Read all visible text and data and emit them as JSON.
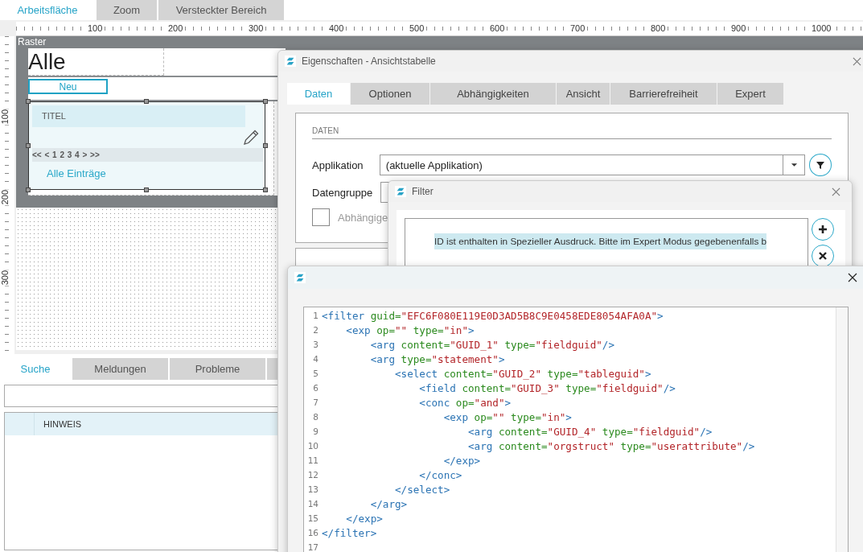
{
  "top_tabs": [
    {
      "label": "Arbeitsfläche",
      "selected": true
    },
    {
      "label": "Zoom",
      "selected": false
    },
    {
      "label": "Versteckter Bereich",
      "selected": false
    }
  ],
  "ruler": {
    "horizontal": [
      "100",
      "200",
      "300",
      "400",
      "500",
      "600",
      "700",
      "800",
      "900",
      "1000"
    ],
    "vertical": [
      "100",
      "200",
      "300"
    ]
  },
  "canvas": {
    "label": "Raster",
    "heading": "Alle",
    "new_button": "Neu",
    "table": {
      "header": "TITEL",
      "pager": "<< < 1 2 3 4 > >>",
      "footer_link": "Alle Einträge"
    }
  },
  "bottom_panel": {
    "tabs": [
      {
        "label": "Suche",
        "selected": true
      },
      {
        "label": "Meldungen",
        "selected": false
      },
      {
        "label": "Probleme",
        "selected": false
      }
    ],
    "table": {
      "columns": [
        "HINWEIS"
      ]
    }
  },
  "properties_dialog": {
    "title": "Eigenschaften - Ansichtstabelle",
    "tabs": [
      {
        "label": "Daten",
        "selected": true
      },
      {
        "label": "Optionen",
        "selected": false
      },
      {
        "label": "Abhängigkeiten",
        "selected": false
      },
      {
        "label": "Ansicht",
        "selected": false
      },
      {
        "label": "Barrierefreiheit",
        "selected": false
      },
      {
        "label": "Expert",
        "selected": false
      }
    ],
    "section": "DATEN",
    "application": {
      "label": "Applikation",
      "value": "(aktuelle Applikation)"
    },
    "data_group": {
      "label": "Datengruppe"
    },
    "checkbox": {
      "label": "Abhängige",
      "checked": false
    }
  },
  "filter_dialog": {
    "title": "Filter",
    "condition": "ID ist enthalten in Spezieller Ausdruck. Bitte im Expert Modus gegebenenfalls b"
  },
  "editor_dialog": {
    "lines": [
      {
        "number": "1",
        "segments": [
          {
            "kind": "tag",
            "text": "<filter "
          },
          {
            "kind": "attr",
            "text": "guid="
          },
          {
            "kind": "value",
            "text": "\"EFC6F080E119E0D3AD5B8C9E0458EDE8054AFA0A\""
          },
          {
            "kind": "tag",
            "text": ">"
          }
        ]
      },
      {
        "number": "2",
        "segments": [
          {
            "kind": "tag",
            "text": "    <exp "
          },
          {
            "kind": "attr",
            "text": "op="
          },
          {
            "kind": "value",
            "text": "\"\""
          },
          {
            "kind": "attr",
            "text": " type="
          },
          {
            "kind": "value",
            "text": "\"in\""
          },
          {
            "kind": "tag",
            "text": ">"
          }
        ]
      },
      {
        "number": "3",
        "segments": [
          {
            "kind": "tag",
            "text": "        <arg "
          },
          {
            "kind": "attr",
            "text": "content="
          },
          {
            "kind": "value",
            "text": "\"GUID_1\""
          },
          {
            "kind": "attr",
            "text": " type="
          },
          {
            "kind": "value",
            "text": "\"fieldguid\""
          },
          {
            "kind": "tag",
            "text": "/>"
          }
        ]
      },
      {
        "number": "4",
        "segments": [
          {
            "kind": "tag",
            "text": "        <arg "
          },
          {
            "kind": "attr",
            "text": "type="
          },
          {
            "kind": "value",
            "text": "\"statement\""
          },
          {
            "kind": "tag",
            "text": ">"
          }
        ]
      },
      {
        "number": "5",
        "segments": [
          {
            "kind": "tag",
            "text": "            <select "
          },
          {
            "kind": "attr",
            "text": "content="
          },
          {
            "kind": "value",
            "text": "\"GUID_2\""
          },
          {
            "kind": "attr",
            "text": " type="
          },
          {
            "kind": "value",
            "text": "\"tableguid\""
          },
          {
            "kind": "tag",
            "text": ">"
          }
        ]
      },
      {
        "number": "6",
        "segments": [
          {
            "kind": "tag",
            "text": "                <field "
          },
          {
            "kind": "attr",
            "text": "content="
          },
          {
            "kind": "value",
            "text": "\"GUID_3\""
          },
          {
            "kind": "attr",
            "text": " type="
          },
          {
            "kind": "value",
            "text": "\"fieldguid\""
          },
          {
            "kind": "tag",
            "text": "/>"
          }
        ]
      },
      {
        "number": "7",
        "segments": [
          {
            "kind": "tag",
            "text": "                <conc "
          },
          {
            "kind": "attr",
            "text": "op="
          },
          {
            "kind": "value",
            "text": "\"and\""
          },
          {
            "kind": "tag",
            "text": ">"
          }
        ]
      },
      {
        "number": "8",
        "segments": [
          {
            "kind": "tag",
            "text": "                    <exp "
          },
          {
            "kind": "attr",
            "text": "op="
          },
          {
            "kind": "value",
            "text": "\"\""
          },
          {
            "kind": "attr",
            "text": " type="
          },
          {
            "kind": "value",
            "text": "\"in\""
          },
          {
            "kind": "tag",
            "text": ">"
          }
        ]
      },
      {
        "number": "9",
        "segments": [
          {
            "kind": "tag",
            "text": "                        <arg "
          },
          {
            "kind": "attr",
            "text": "content="
          },
          {
            "kind": "value",
            "text": "\"GUID_4\""
          },
          {
            "kind": "attr",
            "text": " type="
          },
          {
            "kind": "value",
            "text": "\"fieldguid\""
          },
          {
            "kind": "tag",
            "text": "/>"
          }
        ]
      },
      {
        "number": "10",
        "segments": [
          {
            "kind": "tag",
            "text": "                        <arg "
          },
          {
            "kind": "attr",
            "text": "content="
          },
          {
            "kind": "value",
            "text": "\"orgstruct\""
          },
          {
            "kind": "attr",
            "text": " type="
          },
          {
            "kind": "value",
            "text": "\"userattribute\""
          },
          {
            "kind": "tag",
            "text": "/>"
          }
        ]
      },
      {
        "number": "11",
        "segments": [
          {
            "kind": "tag",
            "text": "                    </exp>"
          }
        ]
      },
      {
        "number": "12",
        "segments": [
          {
            "kind": "tag",
            "text": "                </conc>"
          }
        ]
      },
      {
        "number": "13",
        "segments": [
          {
            "kind": "tag",
            "text": "            </select>"
          }
        ]
      },
      {
        "number": "14",
        "segments": [
          {
            "kind": "tag",
            "text": "        </arg>"
          }
        ]
      },
      {
        "number": "15",
        "segments": [
          {
            "kind": "tag",
            "text": "    </exp>"
          }
        ]
      },
      {
        "number": "16",
        "segments": [
          {
            "kind": "tag",
            "text": "</filter>"
          }
        ]
      },
      {
        "number": "17"
      }
    ]
  }
}
